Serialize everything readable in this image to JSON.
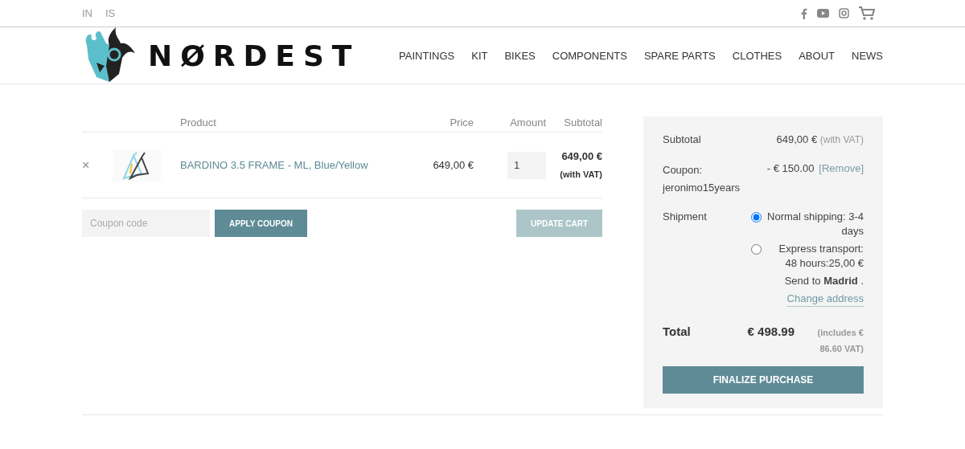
{
  "top_bar": {
    "languages": [
      {
        "label": "IN",
        "selected": false
      },
      {
        "label": "IS",
        "selected": false
      }
    ]
  },
  "header": {
    "logo": "NØRDEST",
    "nav": [
      {
        "label": "PAINTINGS"
      },
      {
        "label": "KIT"
      },
      {
        "label": "BIKES"
      },
      {
        "label": "COMPONENTS"
      },
      {
        "label": "SPARE PARTS"
      },
      {
        "label": "CLOTHES"
      },
      {
        "label": "ABOUT"
      },
      {
        "label": "NEWS"
      }
    ]
  },
  "cart": {
    "columns": [
      "Product",
      "Price",
      "Amount",
      "Subtotal"
    ],
    "rows": [
      {
        "remove": "×",
        "product": "BARDINO 3.5 FRAME - ML, Blue/Yellow",
        "price": "649,00  €",
        "amount": "1",
        "subtotal": "649,00 €",
        "subtotal_note": "(with VAT)"
      }
    ],
    "coupon": {
      "placeholder": "Coupon code"
    },
    "apply_button": "APPLY COUPON",
    "update_button": {
      "label": "UPDATE CART",
      "disabled": true
    }
  },
  "summary": {
    "subtotal": {
      "label": "Subtotal",
      "value": "649,00  €",
      "note": "(with VAT)"
    },
    "coupon": {
      "label": "Coupon: jeronimo15years",
      "value": "- € 150.00",
      "remove": "[Remove]"
    },
    "shipment": {
      "label": "Shipment",
      "options": [
        {
          "label": "Normal shipping: 3-4 days",
          "selected": true
        },
        {
          "label": "Express transport: 48 hours:25,00  €",
          "selected": false
        }
      ],
      "send_to": "Send to **Madrid** .",
      "change": "Change address"
    },
    "total": {
      "label": "Total",
      "value": "€ 498.99",
      "note": "(includes € 86.60  VAT)"
    },
    "button": "FINALIZE PURCHASE"
  }
}
